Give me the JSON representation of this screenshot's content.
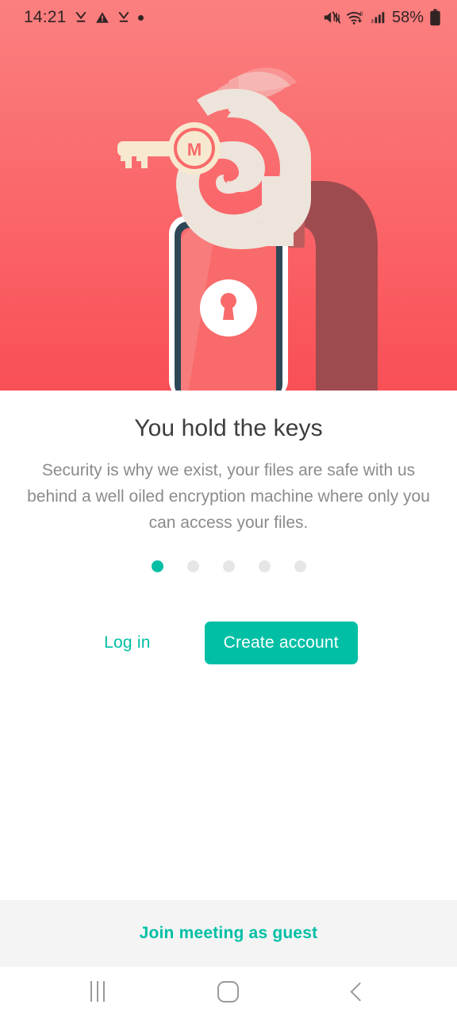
{
  "status_bar": {
    "time": "14:21",
    "battery_percent": "58%",
    "left_icons": [
      "download-complete-icon",
      "warning-triangle-icon",
      "download-complete-icon",
      "dot-indicator-icon"
    ],
    "right_icons": [
      "mute-icon",
      "wifi-6-icon",
      "cellular-signal-icon",
      "battery-icon"
    ]
  },
  "hero": {
    "illustration_name": "hand-holding-mega-key-with-locked-phone",
    "key_letter": "M",
    "colors": {
      "gradient_top": "#FB8080",
      "gradient_bottom": "#F94F56",
      "hand": "#EDE4DB",
      "key": "#F7E9CF",
      "sleeve_dark": "#9E4B4F",
      "sleeve_cuff": "#BC5C5C",
      "phone_frame": "#2E4756",
      "phone_outer": "#FFFFFF",
      "phone_screen": "#F96A6A"
    }
  },
  "onboarding": {
    "title": "You hold the keys",
    "description": "Security is why we exist, your files are safe with us behind a well oiled encryption machine where only you can access your files.",
    "page_count": 5,
    "active_page": 1,
    "accent_color": "#00BFA5"
  },
  "actions": {
    "login_label": "Log in",
    "create_account_label": "Create account"
  },
  "guest": {
    "join_meeting_label": "Join meeting as guest"
  },
  "nav_bar": {
    "recents_label": "recents-icon",
    "home_label": "home-icon",
    "back_label": "back-icon"
  }
}
